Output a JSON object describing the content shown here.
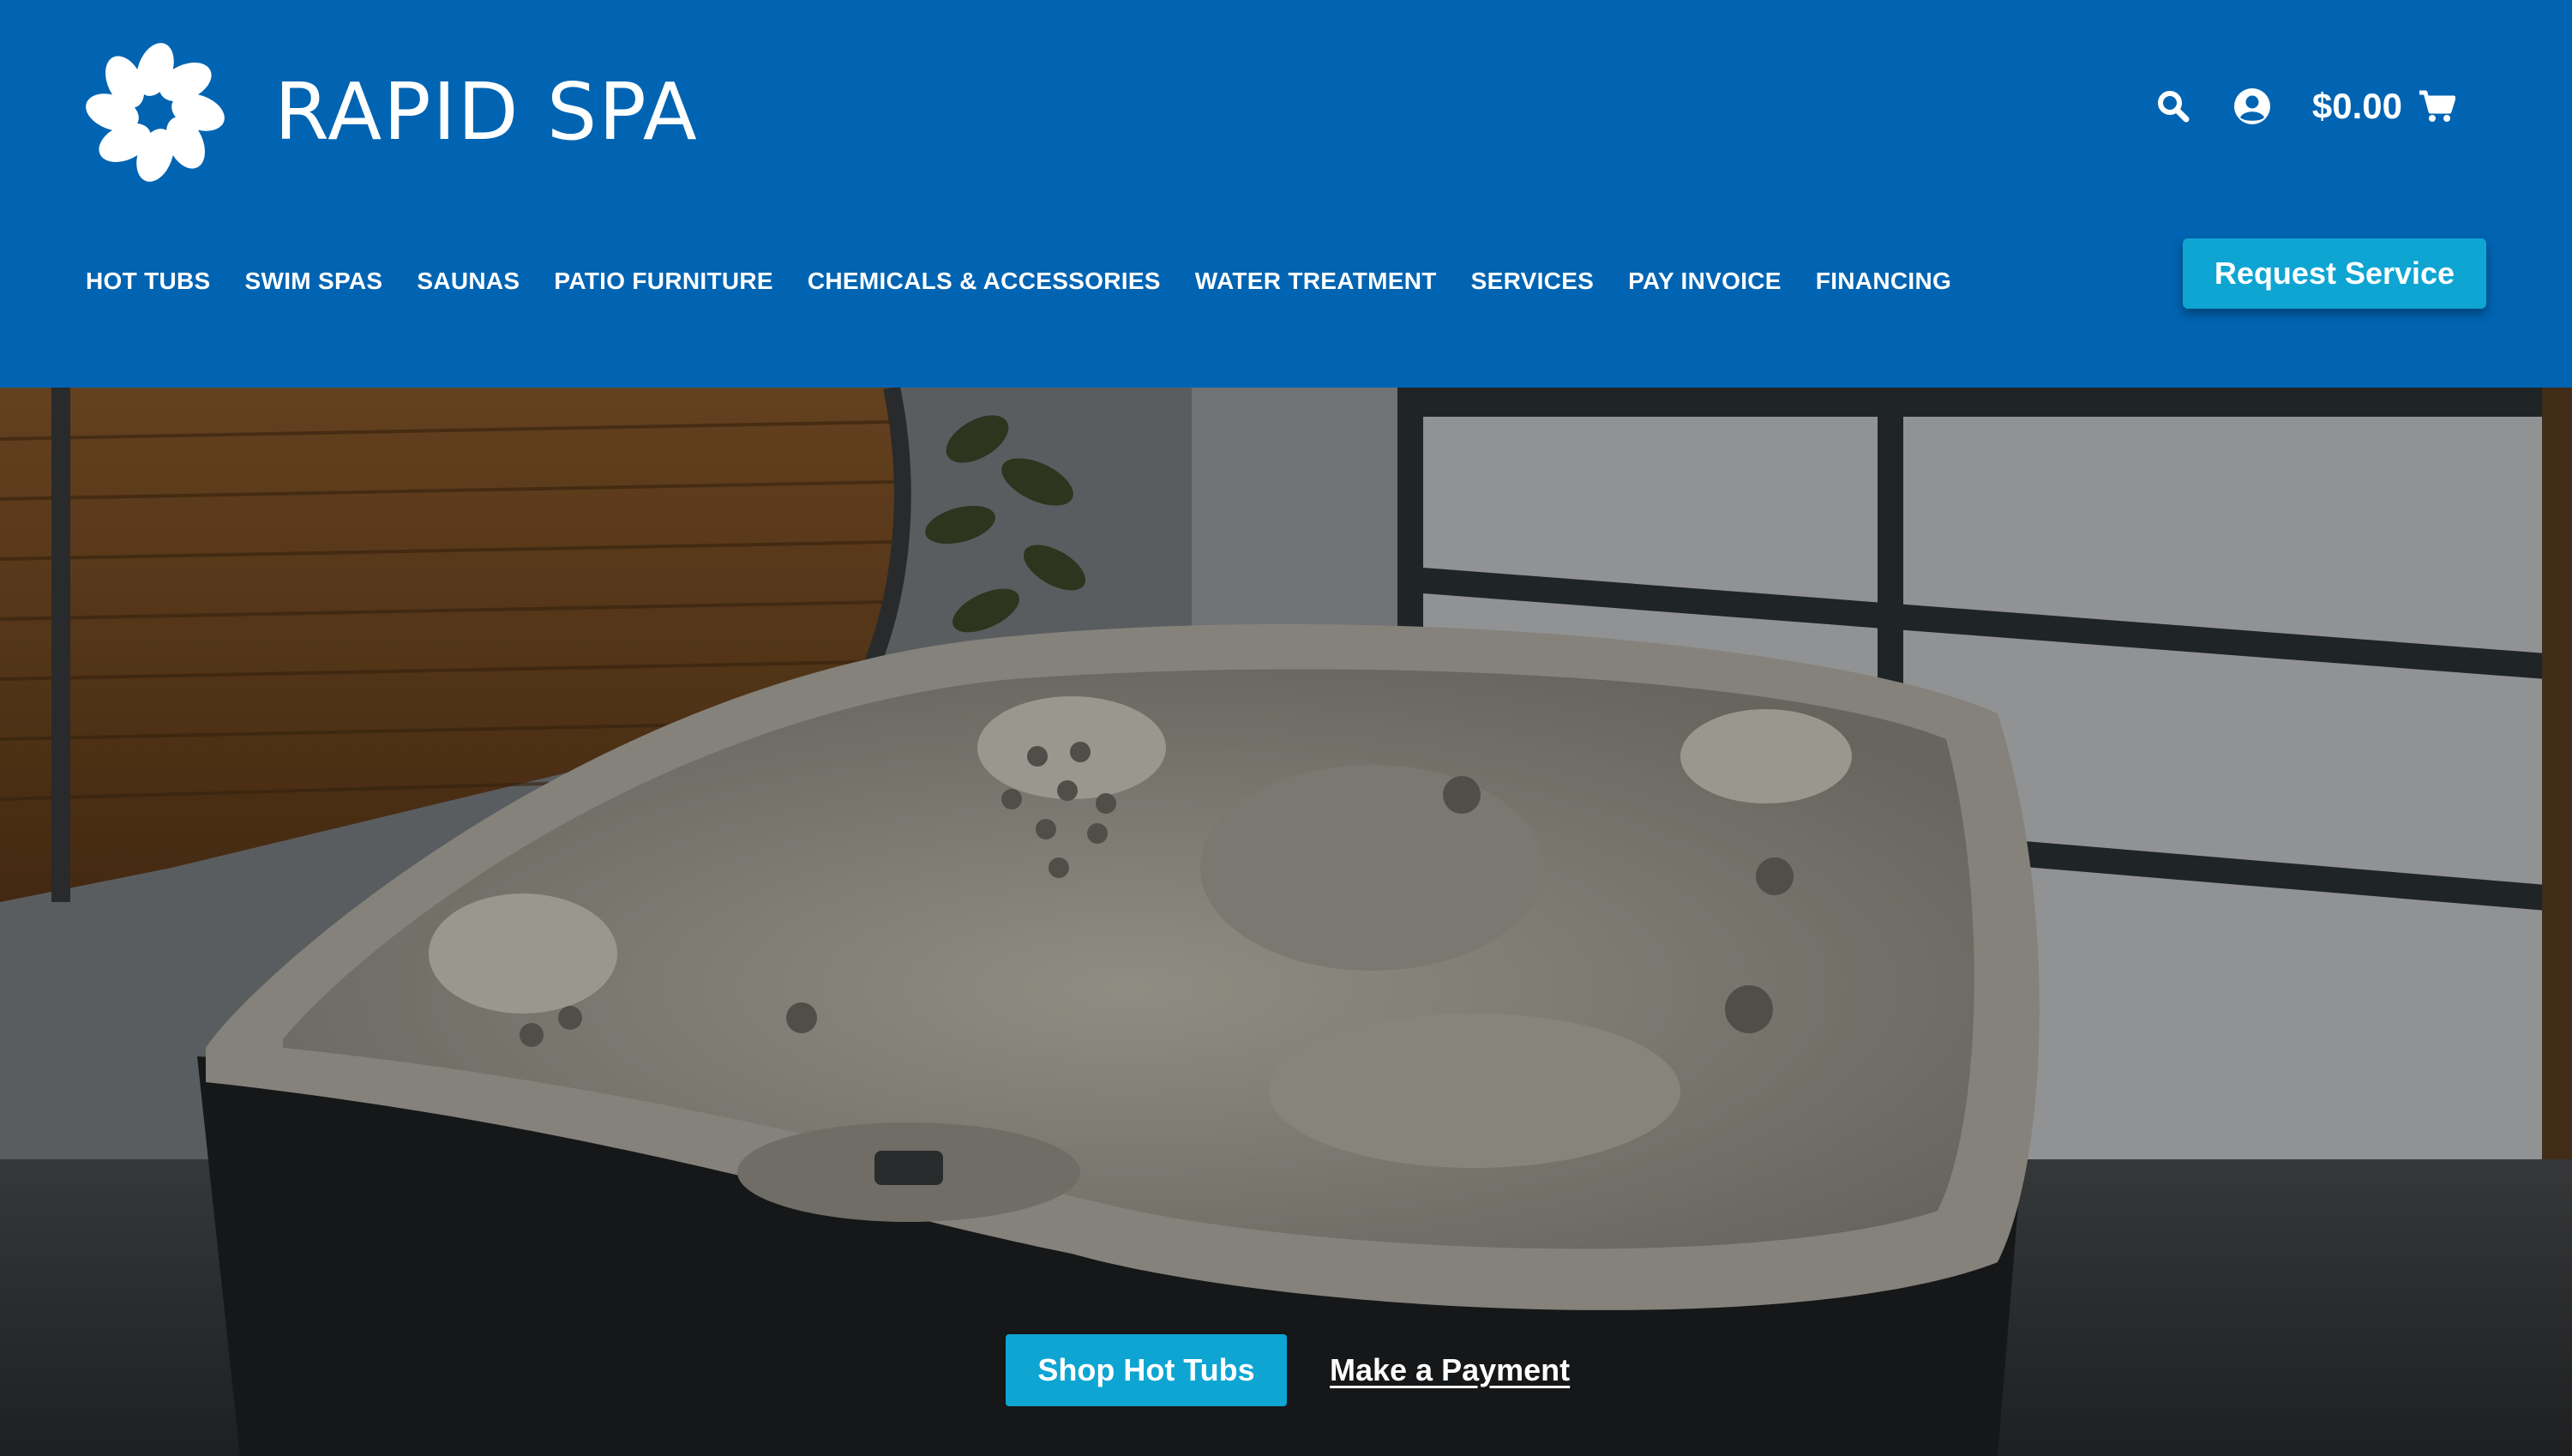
{
  "brand": {
    "name": "RAPID SPA",
    "logo_icon": "pinwheel-logo-icon"
  },
  "header_utils": {
    "search_icon": "search-icon",
    "account_icon": "user-circle-icon",
    "cart_total": "$0.00",
    "cart_icon": "cart-icon"
  },
  "nav": {
    "items": [
      {
        "label": "HOT TUBS"
      },
      {
        "label": "SWIM SPAS"
      },
      {
        "label": "SAUNAS"
      },
      {
        "label": "PATIO FURNITURE"
      },
      {
        "label": "CHEMICALS & ACCESSORIES"
      },
      {
        "label": "WATER TREATMENT"
      },
      {
        "label": "SERVICES"
      },
      {
        "label": "PAY INVOICE"
      },
      {
        "label": "FINANCING"
      }
    ],
    "request_button": "Request Service"
  },
  "hero": {
    "primary_cta": "Shop Hot Tubs",
    "secondary_cta": "Make a Payment"
  },
  "colors": {
    "header_bg": "#0064b2",
    "accent_button": "#0ea5d3",
    "text_light": "#ffffff"
  }
}
